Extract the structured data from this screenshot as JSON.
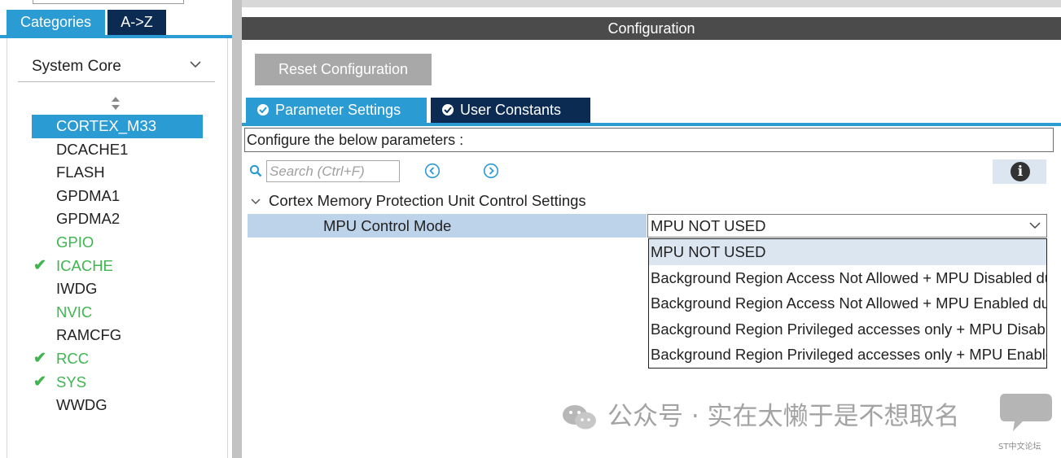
{
  "left_panel": {
    "tabs": {
      "categories": "Categories",
      "az": "A->Z"
    },
    "category_select": "System Core",
    "items": [
      {
        "label": "CORTEX_M33",
        "state": "selected",
        "checked": false
      },
      {
        "label": "DCACHE1",
        "state": "normal",
        "checked": false
      },
      {
        "label": "FLASH",
        "state": "normal",
        "checked": false
      },
      {
        "label": "GPDMA1",
        "state": "normal",
        "checked": false
      },
      {
        "label": "GPDMA2",
        "state": "normal",
        "checked": false
      },
      {
        "label": "GPIO",
        "state": "configured",
        "checked": false
      },
      {
        "label": "ICACHE",
        "state": "configured",
        "checked": true
      },
      {
        "label": "IWDG",
        "state": "normal",
        "checked": false
      },
      {
        "label": "NVIC",
        "state": "configured",
        "checked": false
      },
      {
        "label": "RAMCFG",
        "state": "normal",
        "checked": false
      },
      {
        "label": "RCC",
        "state": "configured",
        "checked": true
      },
      {
        "label": "SYS",
        "state": "configured",
        "checked": true
      },
      {
        "label": "WWDG",
        "state": "normal",
        "checked": false
      }
    ]
  },
  "config": {
    "header": "Configuration",
    "reset_button": "Reset Configuration",
    "tabs": {
      "parameter": "Parameter Settings",
      "user_constants": "User Constants"
    },
    "description": "Configure the below parameters :",
    "search_placeholder": "Search (Ctrl+F)",
    "section_title": "Cortex Memory Protection Unit Control Settings",
    "mpu_label": "MPU Control Mode",
    "mpu_value": "MPU NOT USED",
    "dropdown_options": [
      "MPU NOT USED",
      "Background Region Access Not Allowed + MPU Disabled during hard fault, NMI and FAULTMASK handlers",
      "Background Region Access Not Allowed + MPU Enabled during hard fault, NMI and FAULTMASK handlers",
      "Background Region Privileged accesses only + MPU Disabled during hard fault, NMI and FAULTMASK handlers",
      "Background Region Privileged accesses only + MPU Enabled during hard fault, NMI and FAULTMASK handlers"
    ],
    "dropdown_selected_index": 0
  },
  "watermark": {
    "text": "公众号 · 实在太懒于是不想取名",
    "forum": "ST中文论坛"
  },
  "colors": {
    "accent_blue": "#2b9bd4",
    "dark_navy": "#0b2b52",
    "configured_green": "#3fb550",
    "header_gray": "#4b4b4b",
    "row_highlight": "#bdd3ea"
  }
}
